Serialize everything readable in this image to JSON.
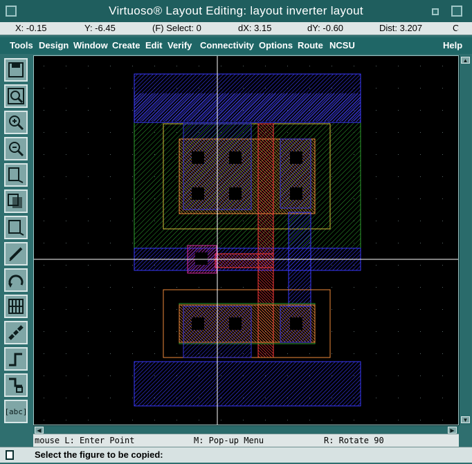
{
  "window": {
    "title": "Virtuoso® Layout Editing: layout inverter layout",
    "corner_badge": "2"
  },
  "status": {
    "x": "X: -0.15",
    "y": "Y: -6.45",
    "select": "(F) Select: 0",
    "dx": "dX: 3.15",
    "dy": "dY: -0.60",
    "dist": "Dist: 3.207",
    "truncated": "C"
  },
  "menu": {
    "items": [
      "Tools",
      "Design",
      "Window",
      "Create",
      "Edit",
      "Verify",
      "Connectivity",
      "Options",
      "Route",
      "NCSU"
    ],
    "help": "Help"
  },
  "toolbar": {
    "tools": [
      {
        "name": "save-tool-icon"
      },
      {
        "name": "zoom-fit-tool-icon"
      },
      {
        "name": "zoom-in-tool-icon"
      },
      {
        "name": "zoom-out-tool-icon"
      },
      {
        "name": "stretch-tool-icon"
      },
      {
        "name": "copy-tool-icon"
      },
      {
        "name": "move-tool-icon"
      },
      {
        "name": "delete-tool-icon"
      },
      {
        "name": "undo-tool-icon"
      },
      {
        "name": "properties-tool-icon"
      },
      {
        "name": "ruler-tool-icon"
      },
      {
        "name": "path-tool-icon"
      },
      {
        "name": "rectangle-tool-icon"
      },
      {
        "name": "label-tool-icon"
      }
    ],
    "label_tool_text": "[abc]"
  },
  "mouse": {
    "left": "mouse L: Enter Point",
    "middle": "M: Pop-up Menu",
    "right": "R: Rotate 90"
  },
  "prompt": {
    "text": "Select the figure to be copied:"
  },
  "colors": {
    "metal_blue": "#1d1dd6",
    "nwell_green": "#1a7a1a",
    "poly_red": "#e02a2a",
    "active_orange": "#e07a2a",
    "contact_black": "#000000",
    "cursor": "#ffffff"
  }
}
